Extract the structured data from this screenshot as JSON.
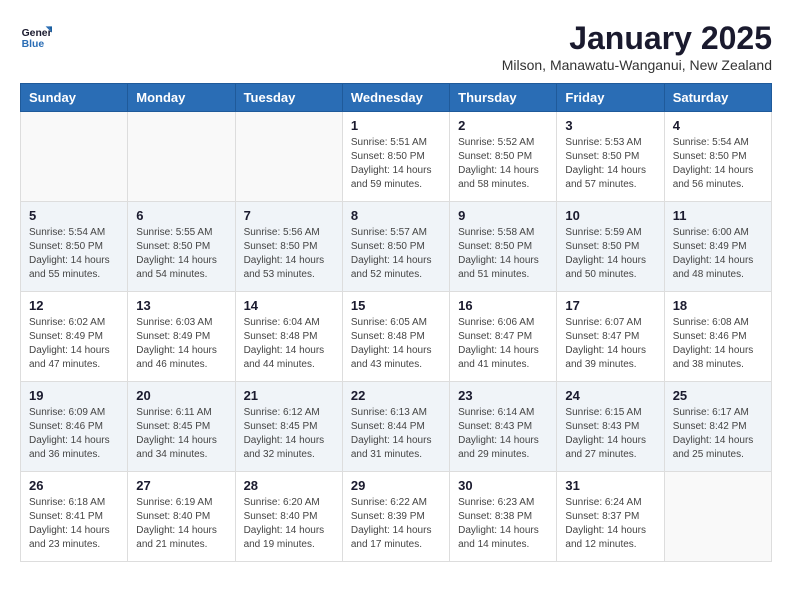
{
  "logo": {
    "line1": "General",
    "line2": "Blue"
  },
  "title": "January 2025",
  "subtitle": "Milson, Manawatu-Wanganui, New Zealand",
  "weekdays": [
    "Sunday",
    "Monday",
    "Tuesday",
    "Wednesday",
    "Thursday",
    "Friday",
    "Saturday"
  ],
  "weeks": [
    [
      {
        "day": "",
        "info": ""
      },
      {
        "day": "",
        "info": ""
      },
      {
        "day": "",
        "info": ""
      },
      {
        "day": "1",
        "info": "Sunrise: 5:51 AM\nSunset: 8:50 PM\nDaylight: 14 hours\nand 59 minutes."
      },
      {
        "day": "2",
        "info": "Sunrise: 5:52 AM\nSunset: 8:50 PM\nDaylight: 14 hours\nand 58 minutes."
      },
      {
        "day": "3",
        "info": "Sunrise: 5:53 AM\nSunset: 8:50 PM\nDaylight: 14 hours\nand 57 minutes."
      },
      {
        "day": "4",
        "info": "Sunrise: 5:54 AM\nSunset: 8:50 PM\nDaylight: 14 hours\nand 56 minutes."
      }
    ],
    [
      {
        "day": "5",
        "info": "Sunrise: 5:54 AM\nSunset: 8:50 PM\nDaylight: 14 hours\nand 55 minutes."
      },
      {
        "day": "6",
        "info": "Sunrise: 5:55 AM\nSunset: 8:50 PM\nDaylight: 14 hours\nand 54 minutes."
      },
      {
        "day": "7",
        "info": "Sunrise: 5:56 AM\nSunset: 8:50 PM\nDaylight: 14 hours\nand 53 minutes."
      },
      {
        "day": "8",
        "info": "Sunrise: 5:57 AM\nSunset: 8:50 PM\nDaylight: 14 hours\nand 52 minutes."
      },
      {
        "day": "9",
        "info": "Sunrise: 5:58 AM\nSunset: 8:50 PM\nDaylight: 14 hours\nand 51 minutes."
      },
      {
        "day": "10",
        "info": "Sunrise: 5:59 AM\nSunset: 8:50 PM\nDaylight: 14 hours\nand 50 minutes."
      },
      {
        "day": "11",
        "info": "Sunrise: 6:00 AM\nSunset: 8:49 PM\nDaylight: 14 hours\nand 48 minutes."
      }
    ],
    [
      {
        "day": "12",
        "info": "Sunrise: 6:02 AM\nSunset: 8:49 PM\nDaylight: 14 hours\nand 47 minutes."
      },
      {
        "day": "13",
        "info": "Sunrise: 6:03 AM\nSunset: 8:49 PM\nDaylight: 14 hours\nand 46 minutes."
      },
      {
        "day": "14",
        "info": "Sunrise: 6:04 AM\nSunset: 8:48 PM\nDaylight: 14 hours\nand 44 minutes."
      },
      {
        "day": "15",
        "info": "Sunrise: 6:05 AM\nSunset: 8:48 PM\nDaylight: 14 hours\nand 43 minutes."
      },
      {
        "day": "16",
        "info": "Sunrise: 6:06 AM\nSunset: 8:47 PM\nDaylight: 14 hours\nand 41 minutes."
      },
      {
        "day": "17",
        "info": "Sunrise: 6:07 AM\nSunset: 8:47 PM\nDaylight: 14 hours\nand 39 minutes."
      },
      {
        "day": "18",
        "info": "Sunrise: 6:08 AM\nSunset: 8:46 PM\nDaylight: 14 hours\nand 38 minutes."
      }
    ],
    [
      {
        "day": "19",
        "info": "Sunrise: 6:09 AM\nSunset: 8:46 PM\nDaylight: 14 hours\nand 36 minutes."
      },
      {
        "day": "20",
        "info": "Sunrise: 6:11 AM\nSunset: 8:45 PM\nDaylight: 14 hours\nand 34 minutes."
      },
      {
        "day": "21",
        "info": "Sunrise: 6:12 AM\nSunset: 8:45 PM\nDaylight: 14 hours\nand 32 minutes."
      },
      {
        "day": "22",
        "info": "Sunrise: 6:13 AM\nSunset: 8:44 PM\nDaylight: 14 hours\nand 31 minutes."
      },
      {
        "day": "23",
        "info": "Sunrise: 6:14 AM\nSunset: 8:43 PM\nDaylight: 14 hours\nand 29 minutes."
      },
      {
        "day": "24",
        "info": "Sunrise: 6:15 AM\nSunset: 8:43 PM\nDaylight: 14 hours\nand 27 minutes."
      },
      {
        "day": "25",
        "info": "Sunrise: 6:17 AM\nSunset: 8:42 PM\nDaylight: 14 hours\nand 25 minutes."
      }
    ],
    [
      {
        "day": "26",
        "info": "Sunrise: 6:18 AM\nSunset: 8:41 PM\nDaylight: 14 hours\nand 23 minutes."
      },
      {
        "day": "27",
        "info": "Sunrise: 6:19 AM\nSunset: 8:40 PM\nDaylight: 14 hours\nand 21 minutes."
      },
      {
        "day": "28",
        "info": "Sunrise: 6:20 AM\nSunset: 8:40 PM\nDaylight: 14 hours\nand 19 minutes."
      },
      {
        "day": "29",
        "info": "Sunrise: 6:22 AM\nSunset: 8:39 PM\nDaylight: 14 hours\nand 17 minutes."
      },
      {
        "day": "30",
        "info": "Sunrise: 6:23 AM\nSunset: 8:38 PM\nDaylight: 14 hours\nand 14 minutes."
      },
      {
        "day": "31",
        "info": "Sunrise: 6:24 AM\nSunset: 8:37 PM\nDaylight: 14 hours\nand 12 minutes."
      },
      {
        "day": "",
        "info": ""
      }
    ]
  ]
}
